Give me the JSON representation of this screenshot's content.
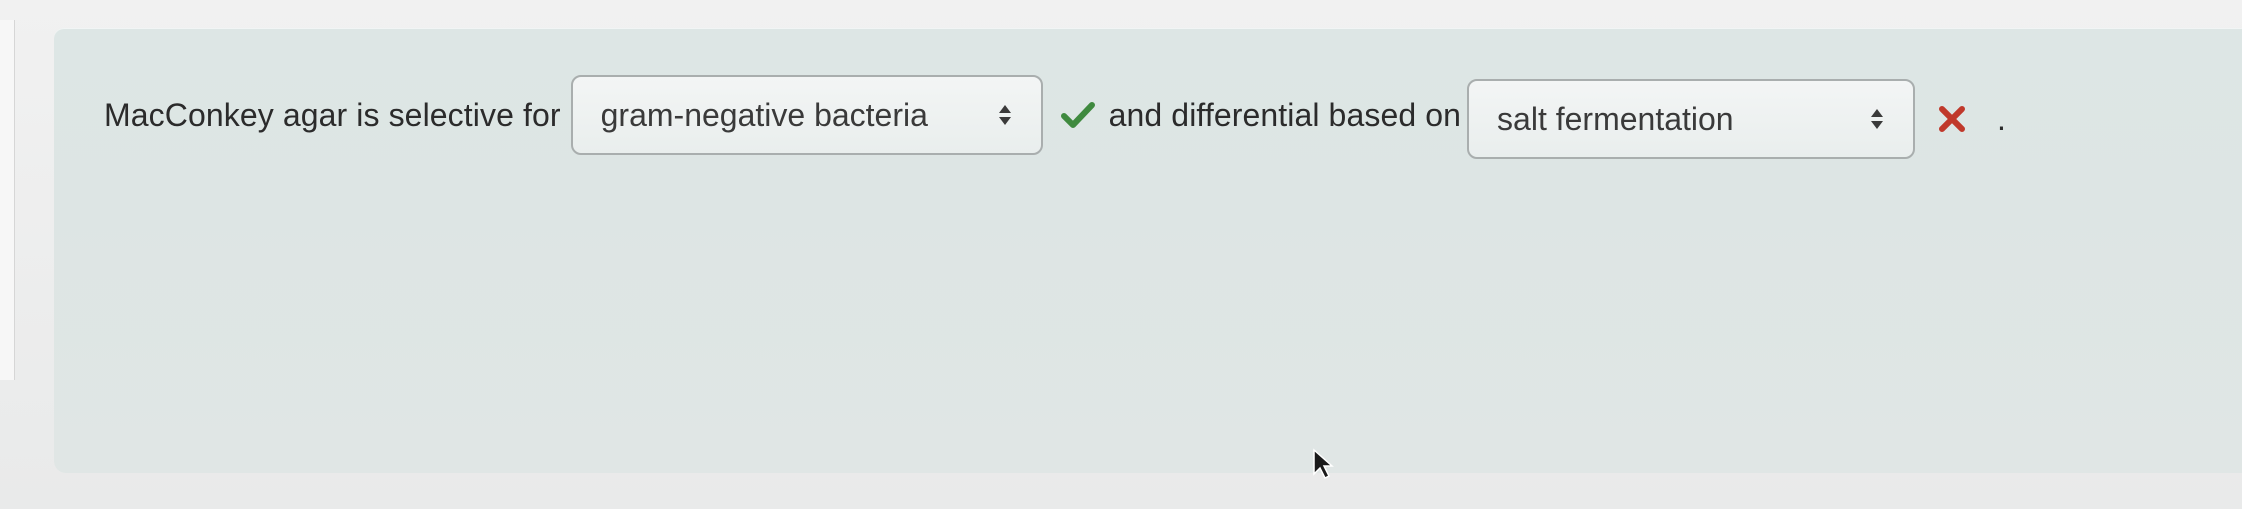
{
  "question": {
    "prefix": "MacConkey agar is selective for",
    "middle": "and differential based on",
    "suffix": "."
  },
  "blank_1": {
    "selected": "gram-negative bacteria",
    "feedback": "correct",
    "feedback_icon": "check-icon",
    "feedback_color": "#3f8a3f"
  },
  "blank_2": {
    "selected": "salt fermentation",
    "feedback": "incorrect",
    "feedback_icon": "cross-icon",
    "feedback_color": "#c0392b"
  },
  "colors": {
    "panel": "#dde6e5",
    "text": "#2b2b2b"
  }
}
